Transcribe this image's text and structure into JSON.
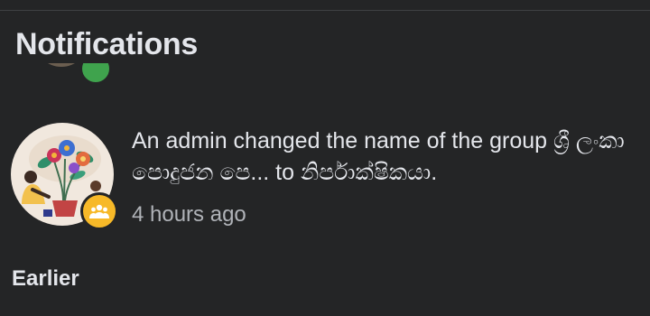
{
  "header": {
    "title": "Notifications"
  },
  "notification": {
    "message": "An admin changed the name of the group ශ්‍රී ලංකා පොදුජන පෙ... to නිර්පාක්ෂිකයා.",
    "time": "4 hours ago",
    "badge_icon": "group-icon",
    "badge_color": "#f7b928"
  },
  "sections": {
    "earlier_label": "Earlier"
  },
  "colors": {
    "background": "#242526",
    "text_primary": "#e4e6eb",
    "text_secondary": "#b0b3b8",
    "partial_badge": "#3fa34d"
  }
}
